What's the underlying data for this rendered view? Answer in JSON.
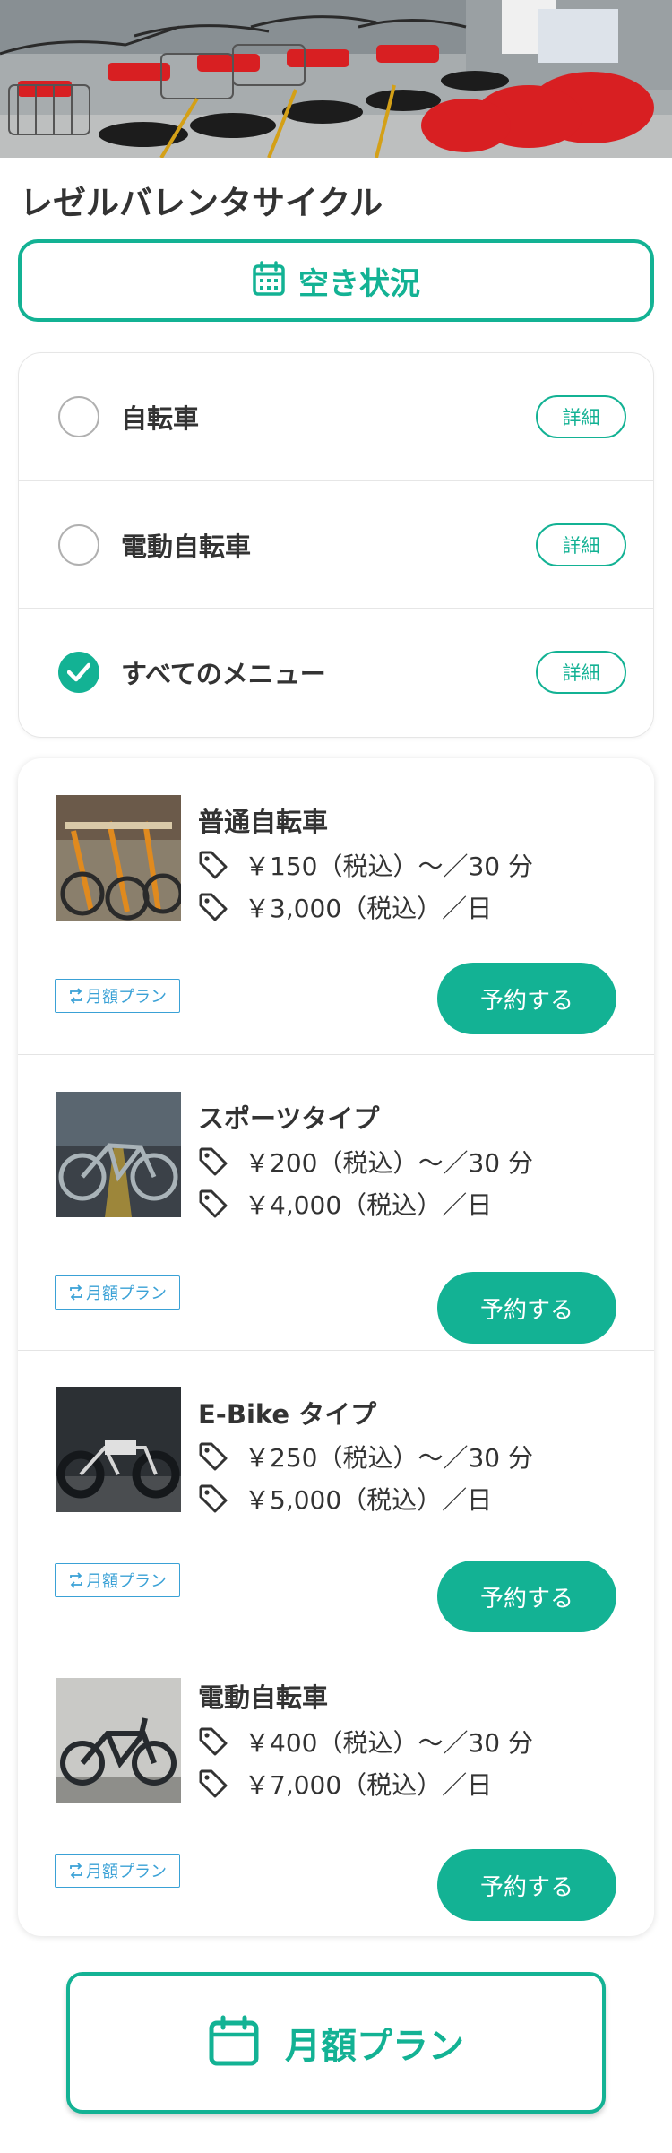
{
  "page": {
    "title": "レゼルバレンタサイクル"
  },
  "availability": {
    "label": "空き状況",
    "icon": "calendar-icon"
  },
  "filters": [
    {
      "label": "自転車",
      "checked": false,
      "detail_label": "詳細"
    },
    {
      "label": "電動自転車",
      "checked": false,
      "detail_label": "詳細"
    },
    {
      "label": "すべてのメニュー",
      "checked": true,
      "detail_label": "詳細"
    }
  ],
  "products": [
    {
      "name": "普通自転車",
      "price_per_30min": "￥150（税込）〜／30 分",
      "price_per_day": "￥3,000（税込）／日",
      "monthly_badge": "月額プラン",
      "reserve_label": "予約する"
    },
    {
      "name": "スポーツタイプ",
      "price_per_30min": "￥200（税込）〜／30 分",
      "price_per_day": "￥4,000（税込）／日",
      "monthly_badge": "月額プラン",
      "reserve_label": "予約する"
    },
    {
      "name": "E-Bike タイプ",
      "price_per_30min": "￥250（税込）〜／30 分",
      "price_per_day": "￥5,000（税込）／日",
      "monthly_badge": "月額プラン",
      "reserve_label": "予約する"
    },
    {
      "name": "電動自転車",
      "price_per_30min": "￥400（税込）〜／30 分",
      "price_per_day": "￥7,000（税込）／日",
      "monthly_badge": "月額プラン",
      "reserve_label": "予約する"
    }
  ],
  "monthly_plan": {
    "label": "月額プラン",
    "icon": "calendar-icon"
  },
  "colors": {
    "accent": "#13b294",
    "badge": "#3aa1d6",
    "text": "#333333"
  }
}
